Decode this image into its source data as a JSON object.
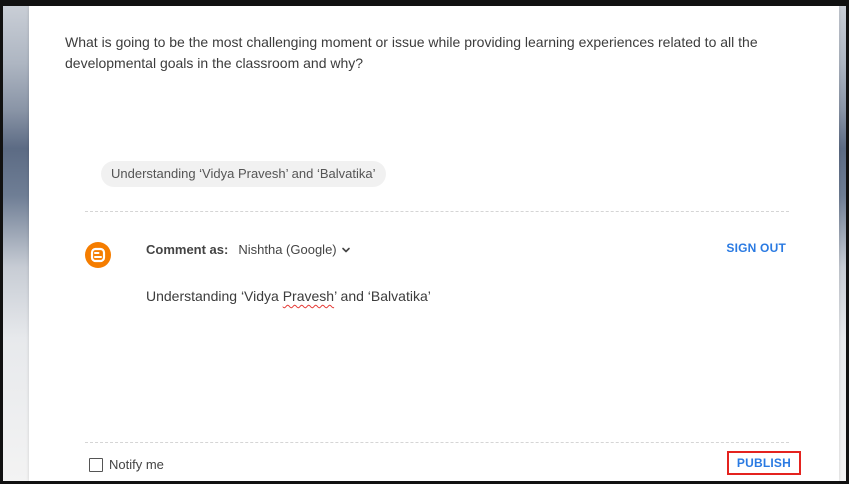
{
  "question": {
    "text": "What is going to be the most challenging moment or issue while providing learning experiences related to all the developmental goals in the classroom and why?"
  },
  "reply_chip": {
    "text": "Understanding ‘Vidya Pravesh’ and ‘Balvatika’"
  },
  "comment_form": {
    "comment_as_label": "Comment as:",
    "account_name": "Nishtha (Google)",
    "sign_out_label": "SIGN OUT",
    "text_before": "Understanding ‘Vidya ",
    "text_misspelled": "Pravesh",
    "text_after": "’ and ‘Balvatika’",
    "notify_label": "Notify me",
    "publish_label": "PUBLISH"
  },
  "icons": {
    "avatar": "blogger-icon",
    "dropdown": "chevron-down-icon"
  },
  "colors": {
    "accent_blue": "#2a7ae2",
    "blogger_orange": "#f57d00",
    "highlight_red": "#e4231f"
  }
}
